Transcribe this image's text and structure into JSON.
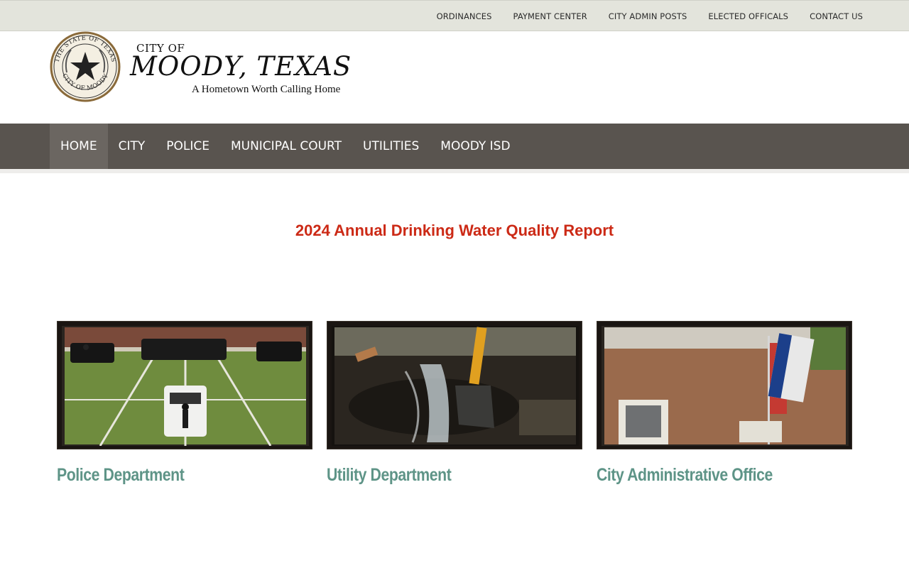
{
  "top_nav": {
    "items": [
      {
        "label": "ORDINANCES"
      },
      {
        "label": "PAYMENT CENTER"
      },
      {
        "label": "CITY ADMIN POSTS"
      },
      {
        "label": "ELECTED OFFICALS"
      },
      {
        "label": "CONTACT US"
      }
    ]
  },
  "logo": {
    "city_of": "CITY OF",
    "name": "MOODY, TEXAS",
    "tagline": "A Hometown Worth Calling Home",
    "seal_text_top": "THE STATE OF TEXAS",
    "seal_text_bottom": "CITY OF MOODY"
  },
  "main_nav": {
    "active": "HOME",
    "items": [
      {
        "label": "HOME"
      },
      {
        "label": "CITY"
      },
      {
        "label": "POLICE"
      },
      {
        "label": "MUNICIPAL COURT"
      },
      {
        "label": "UTILITIES"
      },
      {
        "label": "MOODY ISD"
      }
    ]
  },
  "headline": {
    "label": "2024 Annual Drinking Water Quality Report"
  },
  "cards": [
    {
      "title": "Police Department",
      "image": "police-vehicles-photo"
    },
    {
      "title": "Utility Department",
      "image": "water-main-repair-photo"
    },
    {
      "title": "City Administrative Office",
      "image": "city-hall-building-photo"
    }
  ],
  "colors": {
    "top_bar": "#e3e4dc",
    "main_nav": "#59544f",
    "nav_active": "#6b6661",
    "headline": "#cc2a16",
    "card_title": "#5e9487"
  }
}
